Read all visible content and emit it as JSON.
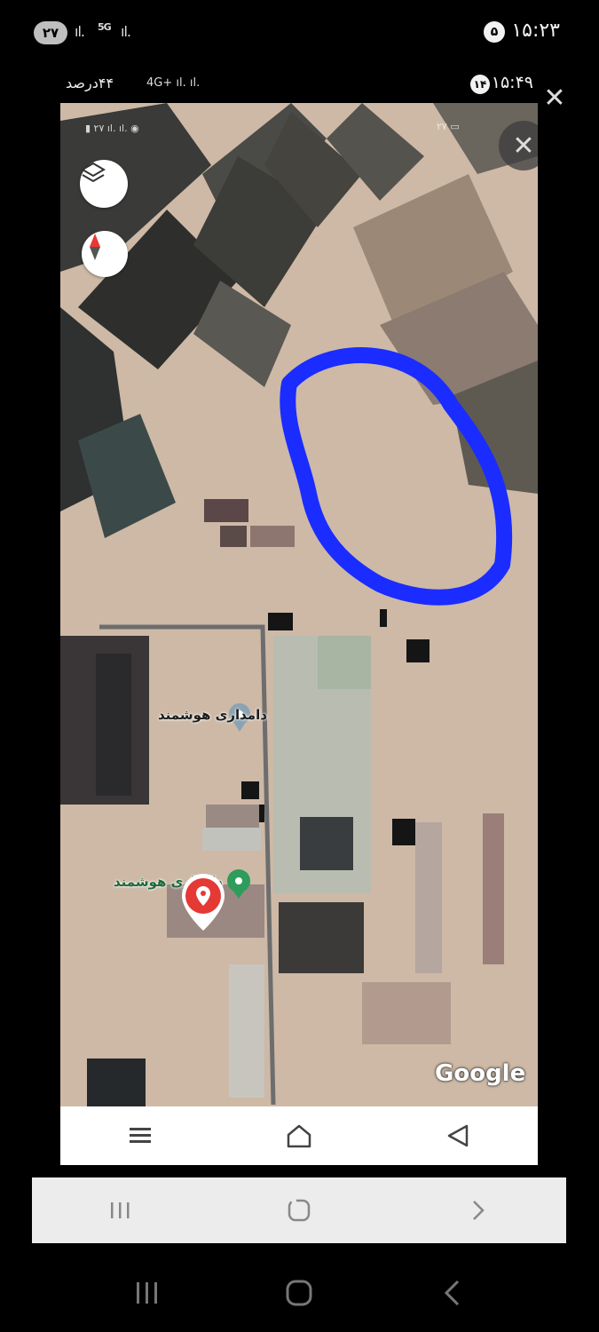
{
  "outer_status": {
    "badge": "۲۷",
    "signal_a": "ıl.",
    "network": "5G",
    "signal_b": "ıl.",
    "time": "۱۵:۲۳",
    "notif_count": "۵"
  },
  "inner_status": {
    "battery_text": "۴۴درصد",
    "network": "4G+ ıl. ıl.",
    "time": "۱۵:۴۹",
    "notif_count": "۱۴"
  },
  "map": {
    "labels": {
      "place1": "دامداری هوشمند",
      "place2": "دامداری هوشمند"
    },
    "google_mark": "Google",
    "tiny_status_left": "▮ ۲۷ ıl. ıl. ◉",
    "tiny_status_right": "۲۷ ▭"
  },
  "icons": {
    "layers": "layers-icon",
    "compass": "compass-icon",
    "close": "close-icon",
    "pin": "location-pin-icon",
    "menu": "menu-icon",
    "home": "home-icon",
    "back": "back-icon",
    "recents": "recents-icon"
  },
  "colors": {
    "highlight": "#1a2cff",
    "pin": "#e53935",
    "green_pin": "#2e9c5a",
    "terrain": "#cdb9a6"
  }
}
